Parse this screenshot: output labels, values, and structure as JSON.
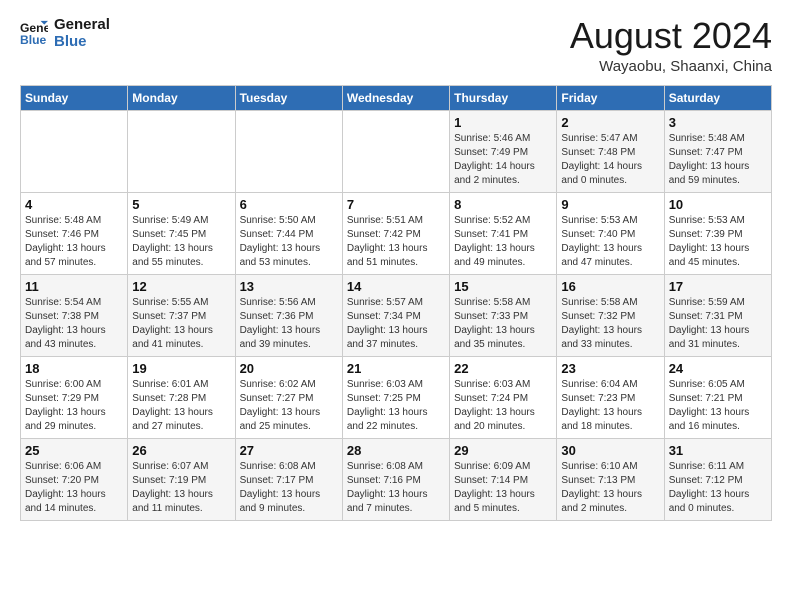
{
  "logo": {
    "line1": "General",
    "line2": "Blue"
  },
  "title": "August 2024",
  "subtitle": "Wayaobu, Shaanxi, China",
  "weekdays": [
    "Sunday",
    "Monday",
    "Tuesday",
    "Wednesday",
    "Thursday",
    "Friday",
    "Saturday"
  ],
  "weeks": [
    [
      {
        "day": "",
        "info": ""
      },
      {
        "day": "",
        "info": ""
      },
      {
        "day": "",
        "info": ""
      },
      {
        "day": "",
        "info": ""
      },
      {
        "day": "1",
        "info": "Sunrise: 5:46 AM\nSunset: 7:49 PM\nDaylight: 14 hours\nand 2 minutes."
      },
      {
        "day": "2",
        "info": "Sunrise: 5:47 AM\nSunset: 7:48 PM\nDaylight: 14 hours\nand 0 minutes."
      },
      {
        "day": "3",
        "info": "Sunrise: 5:48 AM\nSunset: 7:47 PM\nDaylight: 13 hours\nand 59 minutes."
      }
    ],
    [
      {
        "day": "4",
        "info": "Sunrise: 5:48 AM\nSunset: 7:46 PM\nDaylight: 13 hours\nand 57 minutes."
      },
      {
        "day": "5",
        "info": "Sunrise: 5:49 AM\nSunset: 7:45 PM\nDaylight: 13 hours\nand 55 minutes."
      },
      {
        "day": "6",
        "info": "Sunrise: 5:50 AM\nSunset: 7:44 PM\nDaylight: 13 hours\nand 53 minutes."
      },
      {
        "day": "7",
        "info": "Sunrise: 5:51 AM\nSunset: 7:42 PM\nDaylight: 13 hours\nand 51 minutes."
      },
      {
        "day": "8",
        "info": "Sunrise: 5:52 AM\nSunset: 7:41 PM\nDaylight: 13 hours\nand 49 minutes."
      },
      {
        "day": "9",
        "info": "Sunrise: 5:53 AM\nSunset: 7:40 PM\nDaylight: 13 hours\nand 47 minutes."
      },
      {
        "day": "10",
        "info": "Sunrise: 5:53 AM\nSunset: 7:39 PM\nDaylight: 13 hours\nand 45 minutes."
      }
    ],
    [
      {
        "day": "11",
        "info": "Sunrise: 5:54 AM\nSunset: 7:38 PM\nDaylight: 13 hours\nand 43 minutes."
      },
      {
        "day": "12",
        "info": "Sunrise: 5:55 AM\nSunset: 7:37 PM\nDaylight: 13 hours\nand 41 minutes."
      },
      {
        "day": "13",
        "info": "Sunrise: 5:56 AM\nSunset: 7:36 PM\nDaylight: 13 hours\nand 39 minutes."
      },
      {
        "day": "14",
        "info": "Sunrise: 5:57 AM\nSunset: 7:34 PM\nDaylight: 13 hours\nand 37 minutes."
      },
      {
        "day": "15",
        "info": "Sunrise: 5:58 AM\nSunset: 7:33 PM\nDaylight: 13 hours\nand 35 minutes."
      },
      {
        "day": "16",
        "info": "Sunrise: 5:58 AM\nSunset: 7:32 PM\nDaylight: 13 hours\nand 33 minutes."
      },
      {
        "day": "17",
        "info": "Sunrise: 5:59 AM\nSunset: 7:31 PM\nDaylight: 13 hours\nand 31 minutes."
      }
    ],
    [
      {
        "day": "18",
        "info": "Sunrise: 6:00 AM\nSunset: 7:29 PM\nDaylight: 13 hours\nand 29 minutes."
      },
      {
        "day": "19",
        "info": "Sunrise: 6:01 AM\nSunset: 7:28 PM\nDaylight: 13 hours\nand 27 minutes."
      },
      {
        "day": "20",
        "info": "Sunrise: 6:02 AM\nSunset: 7:27 PM\nDaylight: 13 hours\nand 25 minutes."
      },
      {
        "day": "21",
        "info": "Sunrise: 6:03 AM\nSunset: 7:25 PM\nDaylight: 13 hours\nand 22 minutes."
      },
      {
        "day": "22",
        "info": "Sunrise: 6:03 AM\nSunset: 7:24 PM\nDaylight: 13 hours\nand 20 minutes."
      },
      {
        "day": "23",
        "info": "Sunrise: 6:04 AM\nSunset: 7:23 PM\nDaylight: 13 hours\nand 18 minutes."
      },
      {
        "day": "24",
        "info": "Sunrise: 6:05 AM\nSunset: 7:21 PM\nDaylight: 13 hours\nand 16 minutes."
      }
    ],
    [
      {
        "day": "25",
        "info": "Sunrise: 6:06 AM\nSunset: 7:20 PM\nDaylight: 13 hours\nand 14 minutes."
      },
      {
        "day": "26",
        "info": "Sunrise: 6:07 AM\nSunset: 7:19 PM\nDaylight: 13 hours\nand 11 minutes."
      },
      {
        "day": "27",
        "info": "Sunrise: 6:08 AM\nSunset: 7:17 PM\nDaylight: 13 hours\nand 9 minutes."
      },
      {
        "day": "28",
        "info": "Sunrise: 6:08 AM\nSunset: 7:16 PM\nDaylight: 13 hours\nand 7 minutes."
      },
      {
        "day": "29",
        "info": "Sunrise: 6:09 AM\nSunset: 7:14 PM\nDaylight: 13 hours\nand 5 minutes."
      },
      {
        "day": "30",
        "info": "Sunrise: 6:10 AM\nSunset: 7:13 PM\nDaylight: 13 hours\nand 2 minutes."
      },
      {
        "day": "31",
        "info": "Sunrise: 6:11 AM\nSunset: 7:12 PM\nDaylight: 13 hours\nand 0 minutes."
      }
    ]
  ]
}
